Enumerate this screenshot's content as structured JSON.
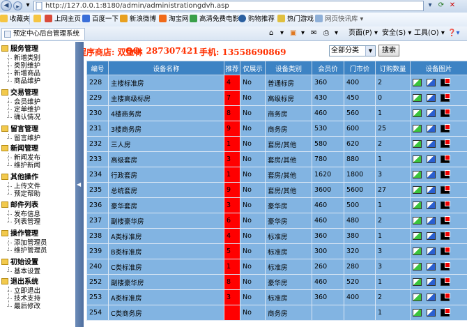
{
  "browser": {
    "url": "http://127.0.0.1:8180/admin/administrationgdvh.asp",
    "favorites": [
      "收藏夹",
      "上网主页",
      "百度一下",
      "新浪微博",
      "淘宝网",
      "高清免费电影",
      "购物推荐",
      "热门游戏",
      "网页快讯库"
    ],
    "tab_title": "预定中心后台管理系统",
    "toolbar": {
      "page": "页面(P)",
      "safety": "安全(S)",
      "tools": "工具(O)"
    }
  },
  "sidebar": {
    "sections": [
      {
        "title": "服务管理",
        "items": [
          "新增类别",
          "类别维护",
          "新增商品",
          "商品维护"
        ]
      },
      {
        "title": "交易管理",
        "items": [
          "会员维护",
          "定单维护",
          "确认情况"
        ]
      },
      {
        "title": "留言管理",
        "items": [
          "留言维护"
        ]
      },
      {
        "title": "新闻管理",
        "items": [
          "新闻发布",
          "维护新闻"
        ]
      },
      {
        "title": "其他操作",
        "items": [
          "上传文件",
          "预定帮助"
        ]
      },
      {
        "title": "邮件列表",
        "items": [
          "发布信息",
          "列表管理"
        ]
      },
      {
        "title": "操作管理",
        "items": [
          "添加管理员",
          "维护管理员"
        ]
      },
      {
        "title": "初始设置",
        "items": [
          "基本设置"
        ]
      },
      {
        "title": "退出系统",
        "items": [
          "立即退出",
          "技术支持",
          "最后修改"
        ]
      }
    ]
  },
  "header": {
    "store": "程序商店: 双鱼林",
    "qq": "QQ: 287307421",
    "phone": "手机: 13558690869",
    "category_select": "全部分类",
    "search_label": "搜索"
  },
  "table": {
    "columns": [
      "编号",
      "设备名称",
      "推荐",
      "仅展示",
      "设备类别",
      "会员价",
      "门市价",
      "订购数量",
      "设备图片"
    ],
    "rows": [
      [
        "228",
        "主楼标准房",
        "4",
        "No",
        "普通标房",
        "360",
        "400",
        "2"
      ],
      [
        "229",
        "主楼高级标房",
        "7",
        "No",
        "高级标房",
        "430",
        "450",
        "0"
      ],
      [
        "230",
        "4楼商务房",
        "8",
        "No",
        "商务房",
        "460",
        "560",
        "1"
      ],
      [
        "231",
        "3楼商务房",
        "9",
        "No",
        "商务房",
        "530",
        "600",
        "25"
      ],
      [
        "232",
        "三人房",
        "1",
        "No",
        "套房/其他",
        "580",
        "620",
        "2"
      ],
      [
        "233",
        "高级套房",
        "3",
        "No",
        "套房/其他",
        "780",
        "880",
        "1"
      ],
      [
        "234",
        "行政套房",
        "1",
        "No",
        "套房/其他",
        "1620",
        "1800",
        "3"
      ],
      [
        "235",
        "总统套房",
        "9",
        "No",
        "套房/其他",
        "3600",
        "5600",
        "27"
      ],
      [
        "236",
        "豪华套房",
        "3",
        "No",
        "豪华房",
        "460",
        "500",
        "1"
      ],
      [
        "237",
        "副楼豪华房",
        "6",
        "No",
        "豪华房",
        "460",
        "480",
        "2"
      ],
      [
        "238",
        "A类标准房",
        "4",
        "No",
        "标准房",
        "360",
        "380",
        "1"
      ],
      [
        "239",
        "B类标准房",
        "5",
        "No",
        "标准房",
        "300",
        "320",
        "3"
      ],
      [
        "240",
        "C类标准房",
        "1",
        "No",
        "标准房",
        "260",
        "280",
        "3"
      ],
      [
        "252",
        "副楼豪华房",
        "8",
        "No",
        "豪华房",
        "460",
        "520",
        "1"
      ],
      [
        "253",
        "A类标准房",
        "3",
        "No",
        "标准房",
        "360",
        "400",
        "2"
      ],
      [
        "254",
        "C类商务房",
        "",
        "No",
        "商务房",
        "",
        "",
        "1"
      ]
    ]
  }
}
